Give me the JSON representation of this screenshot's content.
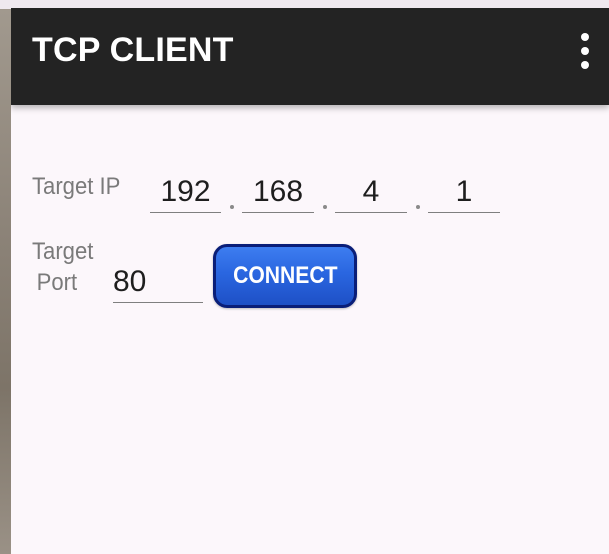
{
  "app_bar": {
    "title": "TCP CLIENT",
    "menu_icon": "more-vert-icon",
    "background_color": "#232323"
  },
  "form": {
    "ip_label": "Target IP",
    "ip_octets": [
      "192",
      "168",
      "4",
      "1"
    ],
    "port_label_line1": "Target",
    "port_label_line2": "Port",
    "port_value": "80",
    "connect_label": "CONNECT",
    "connect_color": "#2a66e0",
    "connect_border_color": "#0a1e78"
  },
  "screen_background": "#fcf7fb"
}
